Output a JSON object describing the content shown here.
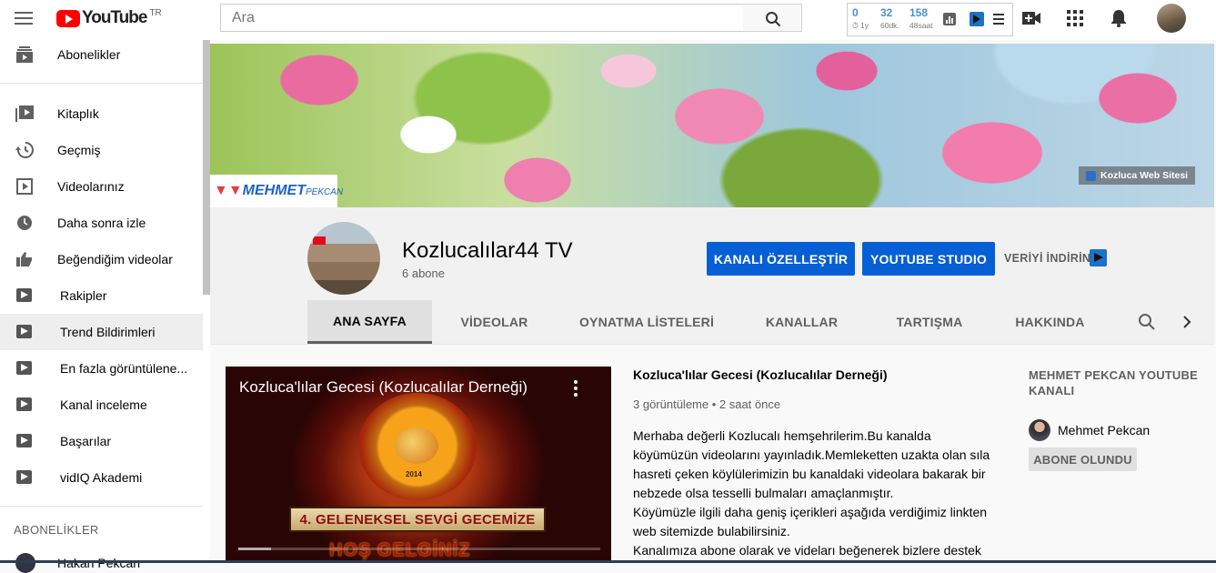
{
  "header": {
    "logo_text": "YouTube",
    "logo_country": "TR",
    "search_placeholder": "Ara",
    "stats": [
      {
        "value": "0",
        "label": "1y"
      },
      {
        "value": "32",
        "label": "60dk."
      },
      {
        "value": "158",
        "label": "48saat"
      }
    ]
  },
  "sidebar": {
    "items": [
      {
        "label": "Abonelikler",
        "icon": "subscriptions-icon"
      },
      {
        "label": "Kitaplık",
        "icon": "library-icon"
      },
      {
        "label": "Geçmiş",
        "icon": "history-icon"
      },
      {
        "label": "Videolarınız",
        "icon": "your-videos-icon"
      },
      {
        "label": "Daha sonra izle",
        "icon": "watch-later-icon"
      },
      {
        "label": "Beğendiğim videolar",
        "icon": "liked-videos-icon"
      },
      {
        "label": "Rakipler",
        "icon": "vidiq-icon"
      },
      {
        "label": "Trend Bildirimleri",
        "icon": "vidiq-icon"
      },
      {
        "label": "En fazla görüntülene...",
        "icon": "vidiq-icon"
      },
      {
        "label": "Kanal inceleme",
        "icon": "vidiq-icon"
      },
      {
        "label": "Başarılar",
        "icon": "vidiq-icon"
      },
      {
        "label": "vidIQ Akademi",
        "icon": "vidiq-icon"
      }
    ],
    "section_title": "ABONELİKLER",
    "subscription_name": "Hakan Pekcan"
  },
  "banner": {
    "logo_text": "MEHMET",
    "logo_small": "PEKCAN",
    "web_link": "Kozluca Web Sitesi"
  },
  "channel": {
    "title": "Kozlucalılar44 TV",
    "subscribers": "6 abone",
    "customize_button": "KANALI ÖZELLEŞTİR",
    "studio_button": "YOUTUBE STUDIO",
    "download_button": "VERİYİ İNDİRİN",
    "tabs": [
      "ANA SAYFA",
      "VİDEOLAR",
      "OYNATMA LİSTELERİ",
      "KANALLAR",
      "TARTIŞMA",
      "HAKKINDA"
    ]
  },
  "featured": {
    "player_title": "Kozluca'lılar Gecesi (Kozlucalılar Derneği)",
    "player_banner_text": "4. GELENEKSEL SEVGİ GECEMİZE",
    "player_welcome": "HOŞ GELGİNİZ",
    "emblem_year": "2014",
    "video_title": "Kozluca'lılar Gecesi (Kozlucalılar Derneği)",
    "meta": "3 görüntüleme • 2 saat önce",
    "description": [
      "Merhaba değerli Kozlucalı hemşehrilerim.Bu kanalda köyümüzün videolarını yayınladık.Memleketten uzakta olan sıla hasreti çeken köylülerimizin bu kanaldaki videolara bakarak bir nebzede olsa tesselli bulmaları amaçlanmıştır.",
      "Köyümüzle ilgili daha geniş içerikleri aşağıda verdiğimiz linkten web sitemizde bulabilirsiniz.",
      "Kanalımıza abone olarak ve videları beğenerek bizlere destek"
    ],
    "progress": 0.09
  },
  "side_panel": {
    "title": "MEHMET PEKCAN YOUTUBE KANALI",
    "channel_name": "Mehmet Pekcan",
    "subscribed_button": "ABONE OLUNDU"
  }
}
